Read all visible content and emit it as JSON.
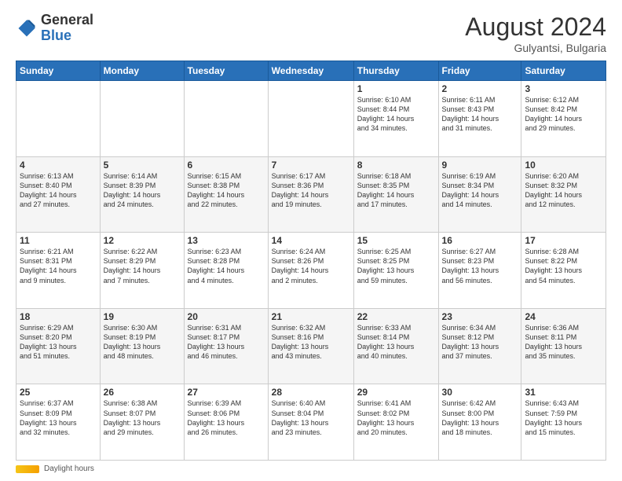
{
  "header": {
    "logo_general": "General",
    "logo_blue": "Blue",
    "month_year": "August 2024",
    "location": "Gulyantsi, Bulgaria"
  },
  "days_of_week": [
    "Sunday",
    "Monday",
    "Tuesday",
    "Wednesday",
    "Thursday",
    "Friday",
    "Saturday"
  ],
  "weeks": [
    [
      {
        "day": "",
        "info": ""
      },
      {
        "day": "",
        "info": ""
      },
      {
        "day": "",
        "info": ""
      },
      {
        "day": "",
        "info": ""
      },
      {
        "day": "1",
        "info": "Sunrise: 6:10 AM\nSunset: 8:44 PM\nDaylight: 14 hours\nand 34 minutes."
      },
      {
        "day": "2",
        "info": "Sunrise: 6:11 AM\nSunset: 8:43 PM\nDaylight: 14 hours\nand 31 minutes."
      },
      {
        "day": "3",
        "info": "Sunrise: 6:12 AM\nSunset: 8:42 PM\nDaylight: 14 hours\nand 29 minutes."
      }
    ],
    [
      {
        "day": "4",
        "info": "Sunrise: 6:13 AM\nSunset: 8:40 PM\nDaylight: 14 hours\nand 27 minutes."
      },
      {
        "day": "5",
        "info": "Sunrise: 6:14 AM\nSunset: 8:39 PM\nDaylight: 14 hours\nand 24 minutes."
      },
      {
        "day": "6",
        "info": "Sunrise: 6:15 AM\nSunset: 8:38 PM\nDaylight: 14 hours\nand 22 minutes."
      },
      {
        "day": "7",
        "info": "Sunrise: 6:17 AM\nSunset: 8:36 PM\nDaylight: 14 hours\nand 19 minutes."
      },
      {
        "day": "8",
        "info": "Sunrise: 6:18 AM\nSunset: 8:35 PM\nDaylight: 14 hours\nand 17 minutes."
      },
      {
        "day": "9",
        "info": "Sunrise: 6:19 AM\nSunset: 8:34 PM\nDaylight: 14 hours\nand 14 minutes."
      },
      {
        "day": "10",
        "info": "Sunrise: 6:20 AM\nSunset: 8:32 PM\nDaylight: 14 hours\nand 12 minutes."
      }
    ],
    [
      {
        "day": "11",
        "info": "Sunrise: 6:21 AM\nSunset: 8:31 PM\nDaylight: 14 hours\nand 9 minutes."
      },
      {
        "day": "12",
        "info": "Sunrise: 6:22 AM\nSunset: 8:29 PM\nDaylight: 14 hours\nand 7 minutes."
      },
      {
        "day": "13",
        "info": "Sunrise: 6:23 AM\nSunset: 8:28 PM\nDaylight: 14 hours\nand 4 minutes."
      },
      {
        "day": "14",
        "info": "Sunrise: 6:24 AM\nSunset: 8:26 PM\nDaylight: 14 hours\nand 2 minutes."
      },
      {
        "day": "15",
        "info": "Sunrise: 6:25 AM\nSunset: 8:25 PM\nDaylight: 13 hours\nand 59 minutes."
      },
      {
        "day": "16",
        "info": "Sunrise: 6:27 AM\nSunset: 8:23 PM\nDaylight: 13 hours\nand 56 minutes."
      },
      {
        "day": "17",
        "info": "Sunrise: 6:28 AM\nSunset: 8:22 PM\nDaylight: 13 hours\nand 54 minutes."
      }
    ],
    [
      {
        "day": "18",
        "info": "Sunrise: 6:29 AM\nSunset: 8:20 PM\nDaylight: 13 hours\nand 51 minutes."
      },
      {
        "day": "19",
        "info": "Sunrise: 6:30 AM\nSunset: 8:19 PM\nDaylight: 13 hours\nand 48 minutes."
      },
      {
        "day": "20",
        "info": "Sunrise: 6:31 AM\nSunset: 8:17 PM\nDaylight: 13 hours\nand 46 minutes."
      },
      {
        "day": "21",
        "info": "Sunrise: 6:32 AM\nSunset: 8:16 PM\nDaylight: 13 hours\nand 43 minutes."
      },
      {
        "day": "22",
        "info": "Sunrise: 6:33 AM\nSunset: 8:14 PM\nDaylight: 13 hours\nand 40 minutes."
      },
      {
        "day": "23",
        "info": "Sunrise: 6:34 AM\nSunset: 8:12 PM\nDaylight: 13 hours\nand 37 minutes."
      },
      {
        "day": "24",
        "info": "Sunrise: 6:36 AM\nSunset: 8:11 PM\nDaylight: 13 hours\nand 35 minutes."
      }
    ],
    [
      {
        "day": "25",
        "info": "Sunrise: 6:37 AM\nSunset: 8:09 PM\nDaylight: 13 hours\nand 32 minutes."
      },
      {
        "day": "26",
        "info": "Sunrise: 6:38 AM\nSunset: 8:07 PM\nDaylight: 13 hours\nand 29 minutes."
      },
      {
        "day": "27",
        "info": "Sunrise: 6:39 AM\nSunset: 8:06 PM\nDaylight: 13 hours\nand 26 minutes."
      },
      {
        "day": "28",
        "info": "Sunrise: 6:40 AM\nSunset: 8:04 PM\nDaylight: 13 hours\nand 23 minutes."
      },
      {
        "day": "29",
        "info": "Sunrise: 6:41 AM\nSunset: 8:02 PM\nDaylight: 13 hours\nand 20 minutes."
      },
      {
        "day": "30",
        "info": "Sunrise: 6:42 AM\nSunset: 8:00 PM\nDaylight: 13 hours\nand 18 minutes."
      },
      {
        "day": "31",
        "info": "Sunrise: 6:43 AM\nSunset: 7:59 PM\nDaylight: 13 hours\nand 15 minutes."
      }
    ]
  ],
  "footer": {
    "daylight_label": "Daylight hours"
  }
}
